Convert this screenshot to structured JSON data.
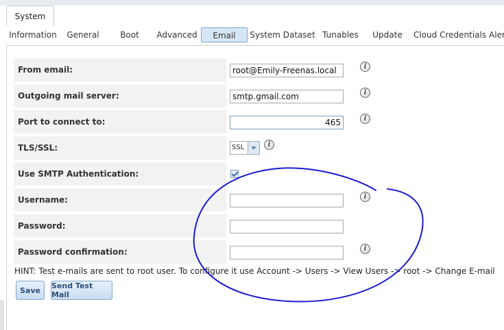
{
  "window": {
    "main_tab": "System"
  },
  "tabs": [
    {
      "label": "Information",
      "active": false
    },
    {
      "label": "General",
      "active": false
    },
    {
      "label": "Boot",
      "active": false
    },
    {
      "label": "Advanced",
      "active": false
    },
    {
      "label": "Email",
      "active": true
    },
    {
      "label": "System Dataset",
      "active": false
    },
    {
      "label": "Tunables",
      "active": false
    },
    {
      "label": "Update",
      "active": false
    },
    {
      "label": "Cloud Credentials",
      "active": false
    },
    {
      "label": "Aler",
      "active": false
    }
  ],
  "form": {
    "from_email": {
      "label": "From email:",
      "value": "root@Emily-Freenas.local"
    },
    "outgoing_server": {
      "label": "Outgoing mail server:",
      "value": "smtp.gmail.com"
    },
    "port": {
      "label": "Port to connect to:",
      "value": "465"
    },
    "tls": {
      "label": "TLS/SSL:",
      "value": "SSL"
    },
    "smtp_auth": {
      "label": "Use SMTP Authentication:",
      "checked": true
    },
    "username": {
      "label": "Username:",
      "value": ""
    },
    "password": {
      "label": "Password:",
      "value": ""
    },
    "password_confirm": {
      "label": "Password confirmation:",
      "value": ""
    }
  },
  "hint": "HINT: Test e-mails are sent to root user. To configure it use Account -> Users -> View Users -> root -> Change E-mail",
  "buttons": {
    "save": "Save",
    "send_test": "Send Test Mail"
  },
  "icons": {
    "info": "i"
  },
  "annotation": {
    "color": "#1a1ad0"
  }
}
